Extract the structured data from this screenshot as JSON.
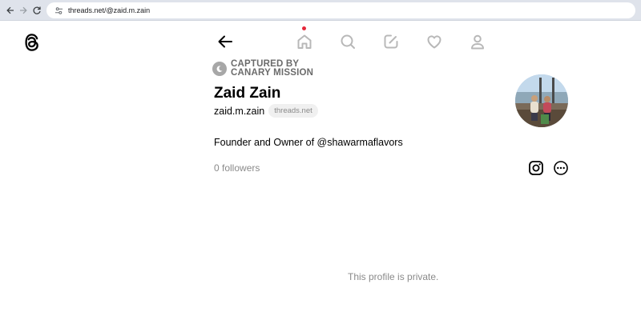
{
  "browser": {
    "url": "threads.net/@zaid.m.zain",
    "icons": [
      "back-arrow-icon",
      "forward-arrow-icon",
      "reload-icon",
      "site-info-icon"
    ]
  },
  "app": {
    "logo_icon": "threads-logo-icon",
    "nav_icons": [
      "back-arrow-icon",
      "home-icon",
      "search-icon",
      "compose-icon",
      "heart-icon",
      "profile-icon"
    ],
    "accent_dot_color": "#e5283a"
  },
  "profile": {
    "captured_line1": "CAPTURED BY",
    "captured_line2": "CANARY MISSION",
    "name": "Zaid Zain",
    "handle": "zaid.m.zain",
    "domain_badge": "threads.net",
    "bio": "Founder and Owner of @shawarmaflavors",
    "followers": "0 followers",
    "private_notice": "This profile is private.",
    "action_icons": [
      "instagram-icon",
      "more-options-icon"
    ]
  }
}
